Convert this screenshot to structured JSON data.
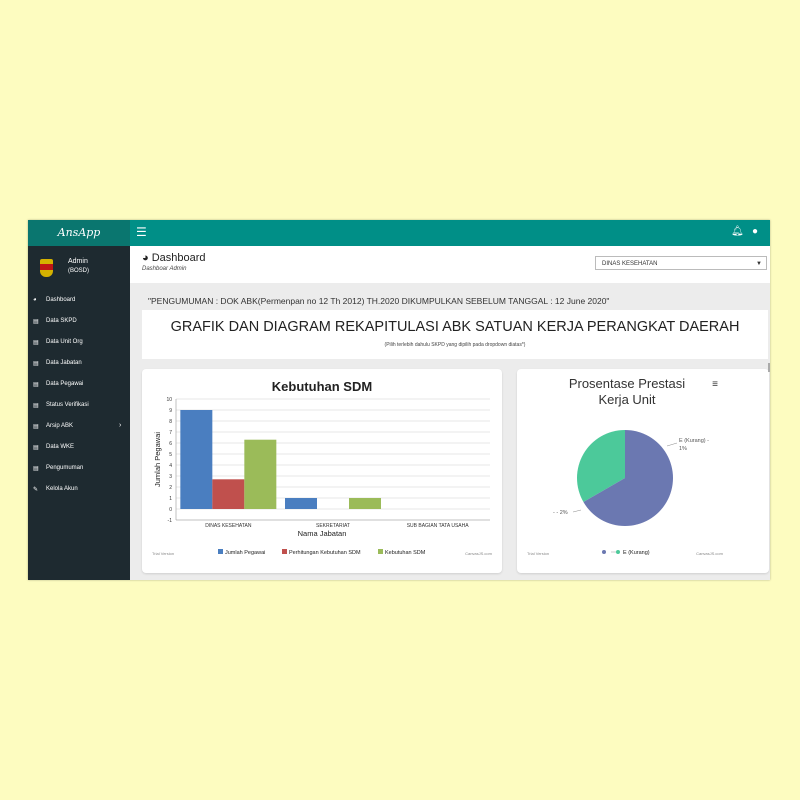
{
  "topbar": {
    "brand": "AnsApp",
    "menu_icon": "hamburger-icon",
    "bell_icon": "bell-icon",
    "user_icon": "user-icon",
    "color": "#008f87"
  },
  "sidebar": {
    "profile": {
      "name": "Admin",
      "role": "(BOSD)"
    },
    "items": [
      {
        "label": "Dashboard",
        "icon": "dashboard-icon",
        "glyph": "◕"
      },
      {
        "label": "Data SKPD",
        "icon": "list-icon",
        "glyph": "▤"
      },
      {
        "label": "Data Unit Org",
        "icon": "list-icon",
        "glyph": "▤"
      },
      {
        "label": "Data Jabatan",
        "icon": "list-icon",
        "glyph": "▤"
      },
      {
        "label": "Data Pegawai",
        "icon": "list-icon",
        "glyph": "▤"
      },
      {
        "label": "Status Verifikasi",
        "icon": "list-icon",
        "glyph": "▤"
      },
      {
        "label": "Arsip ABK",
        "icon": "list-icon",
        "glyph": "▤",
        "chevron": "›"
      },
      {
        "label": "Data WKE",
        "icon": "list-icon",
        "glyph": "▤"
      },
      {
        "label": "Pengumuman",
        "icon": "list-icon",
        "glyph": "▤"
      },
      {
        "label": "Kelola Akun",
        "icon": "edit-icon",
        "glyph": "✎"
      }
    ]
  },
  "header": {
    "title": "Dashboard",
    "subtitle": "Dashboar Admin",
    "title_icon": "dashboard-icon"
  },
  "skpd_select": {
    "value": "DINAS KESEHATAN"
  },
  "announcement": "\"PENGUMUMAN : DOK ABK(Permenpan no 12 Th 2012) TH.2020 DIKUMPULKAN SEBELUM TANGGAL : 12 June 2020\"",
  "recap": {
    "title": "GRAFIK DAN DIAGRAM REKAPITULASI ABK SATUAN KERJA PERANGKAT DAERAH",
    "note": "(Pilih terlebih dahulu SKPD yang dipilih pada dropdown diatas*)"
  },
  "chart_data": [
    {
      "type": "bar",
      "title": "Kebutuhan SDM",
      "xlabel": "Nama Jabatan",
      "ylabel": "Jumlah Pegawai",
      "categories": [
        "DINAS KESEHATAN",
        "SEKRETARIAT",
        "SUB BAGIAN TATA USAHA"
      ],
      "series": [
        {
          "name": "Jumlah Pegawai",
          "color": "#4a7ec0",
          "values": [
            9,
            1,
            0
          ]
        },
        {
          "name": "Perhitungan Kebutuhan SDM",
          "color": "#c0504d",
          "values": [
            2.7,
            0,
            0
          ]
        },
        {
          "name": "Kebutuhan SDM",
          "color": "#9bbb59",
          "values": [
            6.3,
            1,
            0
          ]
        }
      ],
      "ylim": [
        -1,
        10
      ],
      "yticks": [
        "-1",
        "0",
        "1",
        "2",
        "3",
        "4",
        "5",
        "6",
        "7",
        "8",
        "9",
        "10"
      ],
      "grid": true,
      "legend": "bottom",
      "footer_left": "Trial Version",
      "footer_right": "CanvasJS.com"
    },
    {
      "type": "pie",
      "title": "Prosentase Prestasi Kerja Unit",
      "menu_icon": "hamburger-icon",
      "slices": [
        {
          "name": "",
          "color": "#6b78b1",
          "value": 2,
          "label": "- - 2%"
        },
        {
          "name": "E (Kurang)",
          "color": "#4cc99a",
          "value": 1,
          "label": "E (Kurang) - 1%"
        }
      ],
      "legend": "bottom",
      "footer_left": "Trial Version",
      "footer_right": "CanvasJS.com"
    }
  ]
}
